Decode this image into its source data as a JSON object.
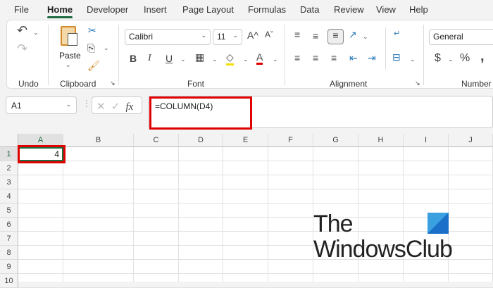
{
  "tabs": [
    "File",
    "Home",
    "Developer",
    "Insert",
    "Page Layout",
    "Formulas",
    "Data",
    "Review",
    "View",
    "Help"
  ],
  "active_tab": "Home",
  "ribbon": {
    "groups": {
      "undo": "Undo",
      "clipboard": "Clipboard",
      "font": "Font",
      "alignment": "Alignment",
      "number": "Number"
    },
    "paste_label": "Paste",
    "font_name": "Calibri",
    "font_size": "11",
    "number_format": "General",
    "bold": "B",
    "italic": "I",
    "underline": "U",
    "font_color_glyph": "A",
    "grow": "A^",
    "shrink": "Aˇ",
    "currency": "$",
    "percent": "%",
    "comma": ","
  },
  "name_box": "A1",
  "fx_label": "fx",
  "formula": "=COLUMN(D4)",
  "columns": [
    "A",
    "B",
    "C",
    "D",
    "E",
    "F",
    "G",
    "H",
    "I",
    "J"
  ],
  "rows": [
    "1",
    "2",
    "3",
    "4",
    "5",
    "6",
    "7",
    "8",
    "9",
    "10"
  ],
  "cells": {
    "A1": "4"
  },
  "watermark": {
    "line1": "The",
    "line2": "WindowsClub"
  },
  "colors": {
    "accent": "#1e6b41",
    "highlight": "#e00000"
  }
}
